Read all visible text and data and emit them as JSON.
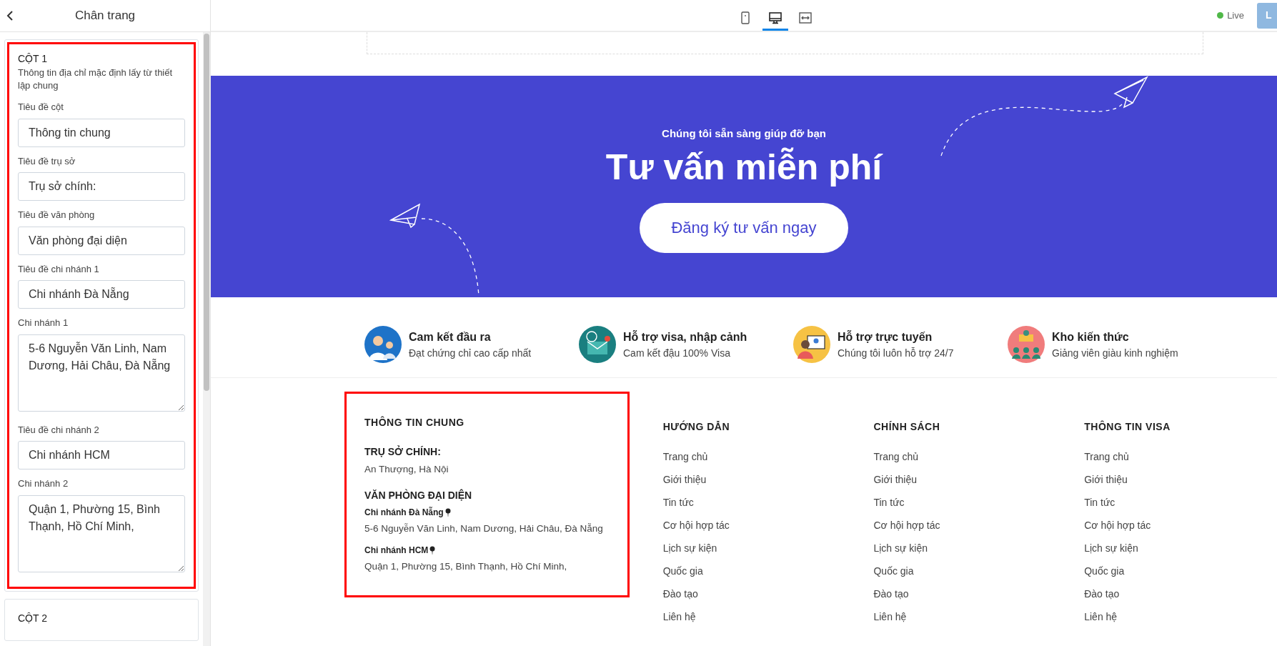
{
  "panel": {
    "title": "Chân trang",
    "sections": [
      {
        "title": "CỘT 1",
        "highlighted": true,
        "note": "Thông tin địa chỉ mặc định lấy từ thiết lập chung",
        "fields": [
          {
            "kind": "input",
            "label": "Tiêu đề cột",
            "value": "Thông tin chung"
          },
          {
            "kind": "input",
            "label": "Tiêu đề trụ sở",
            "value": "Trụ sở chính:"
          },
          {
            "kind": "input",
            "label": "Tiêu đề văn phòng",
            "value": "Văn phòng đại diện"
          },
          {
            "kind": "input",
            "label": "Tiêu đề chi nhánh 1",
            "value": "Chi nhánh Đà Nẵng"
          },
          {
            "kind": "textarea",
            "label": "Chi nhánh 1",
            "value": "5-6 Nguyễn Văn Linh, Nam Dương, Hải Châu, Đà Nẵng"
          },
          {
            "kind": "input",
            "label": "Tiêu đề chi nhánh 2",
            "value": "Chi nhánh HCM"
          },
          {
            "kind": "textarea",
            "label": "Chi nhánh 2",
            "value": "Quận 1, Phường 15, Bình Thạnh, Hồ Chí Minh,"
          }
        ]
      },
      {
        "title": "CỘT 2",
        "highlighted": false
      }
    ]
  },
  "toolbar": {
    "devices": [
      {
        "kind": "mobile",
        "selected": false
      },
      {
        "kind": "desktop",
        "selected": true
      },
      {
        "kind": "fullwidth",
        "selected": false
      }
    ],
    "status": "Live",
    "button": "L"
  },
  "banner": {
    "subtitle": "Chúng tôi sẵn sàng giúp đỡ bạn",
    "title": "Tư vấn miễn phí",
    "button": "Đăng ký tư vấn ngay"
  },
  "features": [
    {
      "kind": "consultants",
      "title": "Cam kết đầu ra",
      "text": "Đạt chứng chỉ cao cấp nhất"
    },
    {
      "kind": "mail",
      "title": "Hỗ trợ visa, nhập cảnh",
      "text": "Cam kết đậu 100% Visa"
    },
    {
      "kind": "video",
      "title": "Hỗ trợ trực tuyến",
      "text": "Chúng tôi luôn hỗ trợ 24/7"
    },
    {
      "kind": "presenter",
      "title": "Kho kiến thức",
      "text": "Giảng viên giàu kinh nghiệm"
    }
  ],
  "footer": {
    "columns": [
      {
        "kind": "contact",
        "highlighted": true,
        "title": "THÔNG TIN CHUNG",
        "head_office_title": "TRỤ SỞ CHÍNH:",
        "head_office": "An Thượng, Hà Nội",
        "office_title": "VĂN PHÒNG ĐẠI DIỆN",
        "branches": [
          {
            "name": "Chi nhánh Đà Nẵng",
            "address": "5-6 Nguyễn Văn Linh, Nam Dương, Hải Châu, Đà Nẵng"
          },
          {
            "name": "Chi nhánh HCM",
            "address": "Quận 1, Phường 15, Bình Thạnh, Hồ Chí Minh,"
          }
        ]
      },
      {
        "kind": "links",
        "title": "HƯỚNG DẪN",
        "links": [
          "Trang chủ",
          "Giới thiệu",
          "Tin tức",
          "Cơ hội hợp tác",
          "Lịch sự kiện",
          "Quốc gia",
          "Đào tạo",
          "Liên hệ"
        ]
      },
      {
        "kind": "links",
        "title": "CHÍNH SÁCH",
        "links": [
          "Trang chủ",
          "Giới thiệu",
          "Tin tức",
          "Cơ hội hợp tác",
          "Lịch sự kiện",
          "Quốc gia",
          "Đào tạo",
          "Liên hệ"
        ]
      },
      {
        "kind": "links",
        "title": "THÔNG TIN VISA",
        "links": [
          "Trang chủ",
          "Giới thiệu",
          "Tin tức",
          "Cơ hội hợp tác",
          "Lịch sự kiện",
          "Quốc gia",
          "Đào tạo",
          "Liên hệ"
        ]
      }
    ]
  }
}
